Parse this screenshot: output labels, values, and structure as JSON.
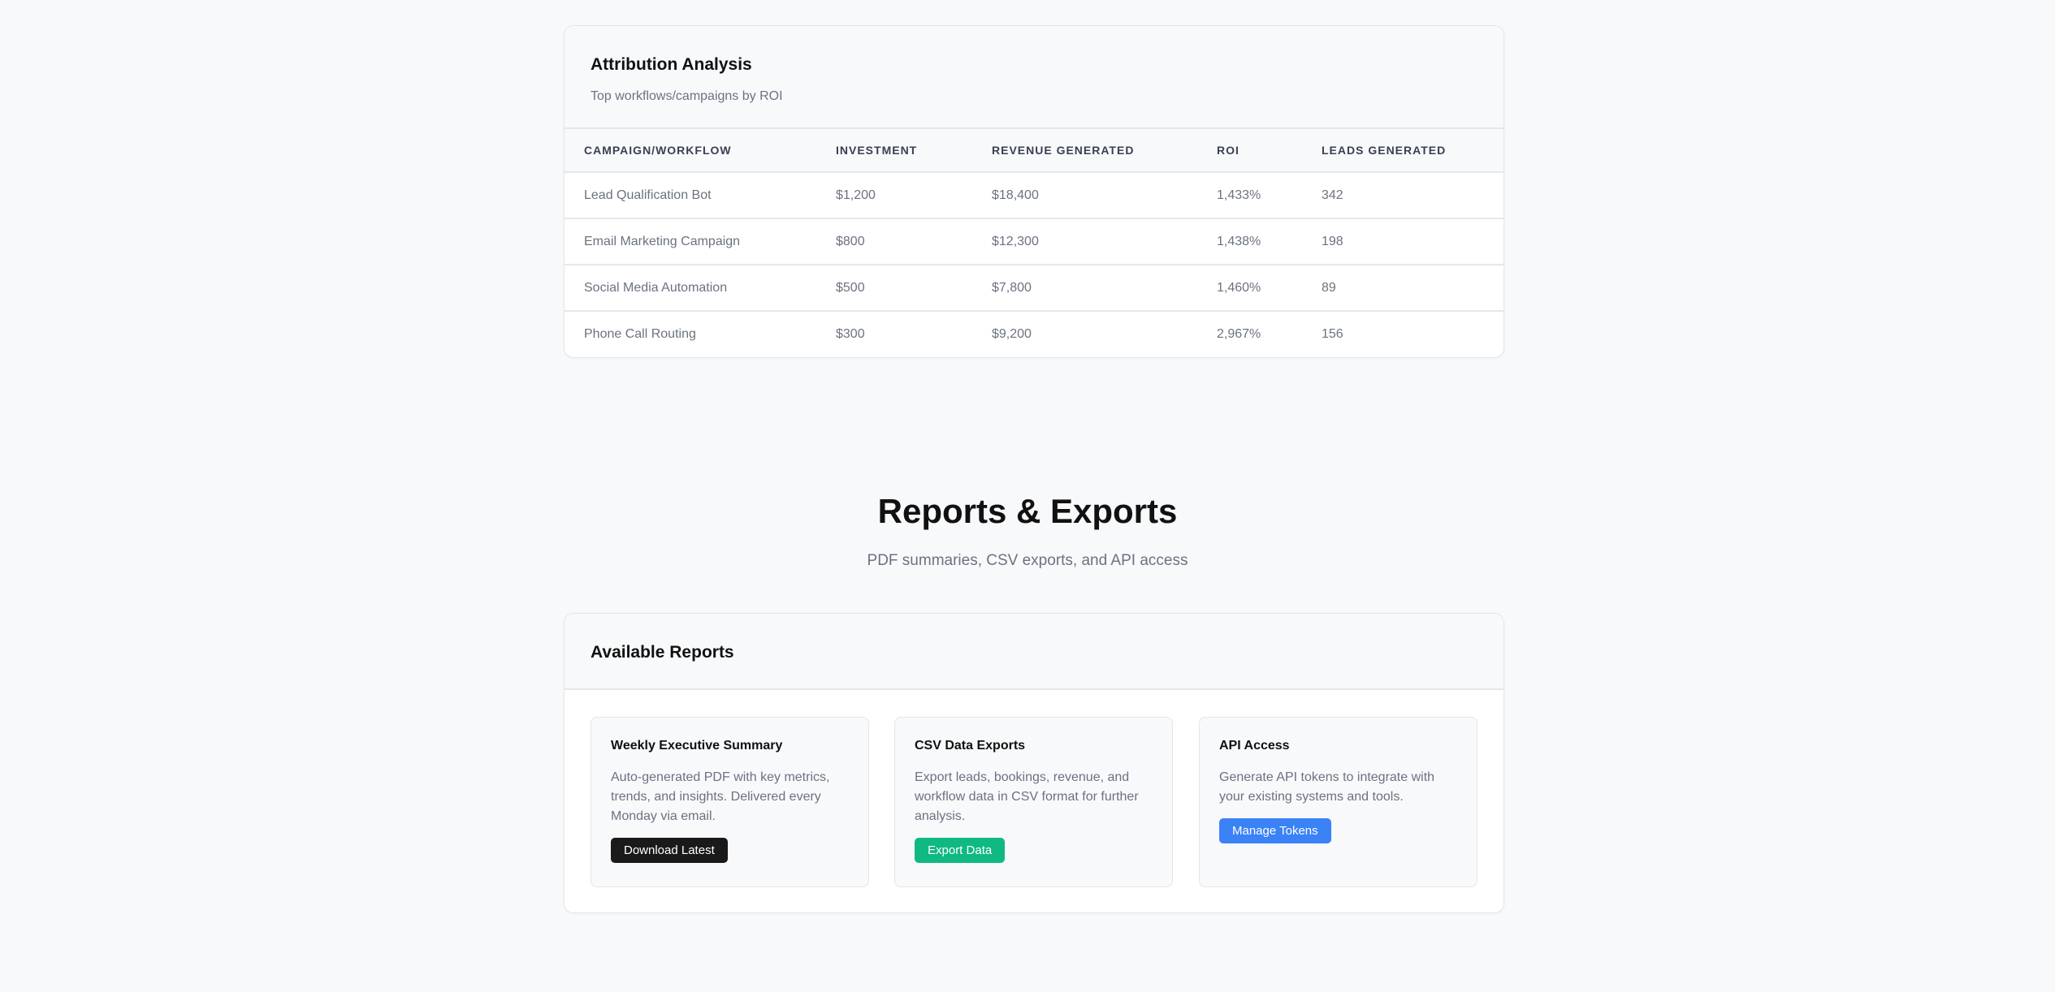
{
  "attribution": {
    "title": "Attribution Analysis",
    "subtitle": "Top workflows/campaigns by ROI",
    "columns": [
      "CAMPAIGN/WORKFLOW",
      "INVESTMENT",
      "REVENUE GENERATED",
      "ROI",
      "LEADS GENERATED"
    ],
    "rows": [
      [
        "Lead Qualification Bot",
        "$1,200",
        "$18,400",
        "1,433%",
        "342"
      ],
      [
        "Email Marketing Campaign",
        "$800",
        "$12,300",
        "1,438%",
        "198"
      ],
      [
        "Social Media Automation",
        "$500",
        "$7,800",
        "1,460%",
        "89"
      ],
      [
        "Phone Call Routing",
        "$300",
        "$9,200",
        "2,967%",
        "156"
      ]
    ]
  },
  "reports": {
    "title": "Reports & Exports",
    "subtitle": "PDF summaries, CSV exports, and API access",
    "card_title": "Available Reports",
    "items": [
      {
        "title": "Weekly Executive Summary",
        "description": "Auto-generated PDF with key metrics, trends, and insights. Delivered every Monday via email.",
        "button": "Download Latest",
        "color": "#1a1a1a"
      },
      {
        "title": "CSV Data Exports",
        "description": "Export leads, bookings, revenue, and workflow data in CSV format for further analysis.",
        "button": "Export Data",
        "color": "#10b981"
      },
      {
        "title": "API Access",
        "description": "Generate API tokens to integrate with your existing systems and tools.",
        "button": "Manage Tokens",
        "color": "#3b82f6"
      }
    ]
  }
}
